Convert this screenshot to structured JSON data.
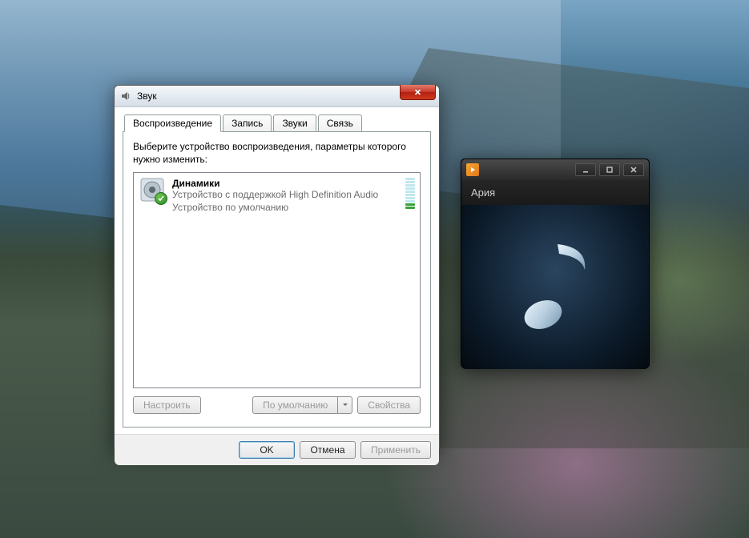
{
  "sound_dialog": {
    "title": "Звук",
    "tabs": {
      "playback": "Воспроизведение",
      "recording": "Запись",
      "sounds": "Звуки",
      "communications": "Связь"
    },
    "instruction": "Выберите устройство воспроизведения, параметры которого нужно изменить:",
    "device": {
      "name": "Динамики",
      "description": "Устройство с поддержкой High Definition Audio",
      "status": "Устройство по умолчанию"
    },
    "buttons": {
      "configure": "Настроить",
      "set_default": "По умолчанию",
      "properties": "Свойства",
      "ok": "OK",
      "cancel": "Отмена",
      "apply": "Применить"
    }
  },
  "media_player": {
    "now_playing": "Ария"
  }
}
